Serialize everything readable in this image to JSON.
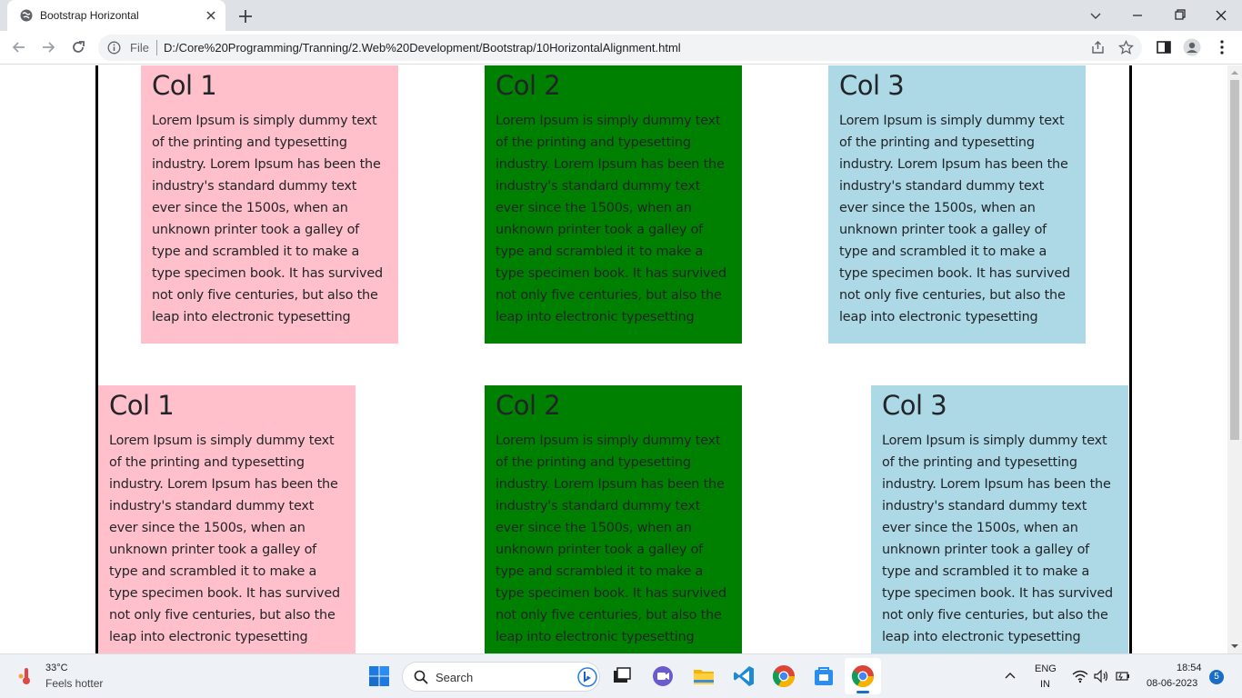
{
  "browser": {
    "tab_title": "Bootstrap Horizontal",
    "omnibox": {
      "scheme_label": "File",
      "url": "D:/Core%20Programming/Tranning/2.Web%20Development/Bootstrap/10HorizontalAlignment.html"
    }
  },
  "page": {
    "row1": [
      {
        "heading": "Col 1",
        "text": "Lorem Ipsum is simply dummy text of the printing and typesetting industry. Lorem Ipsum has been the industry's standard dummy text ever since the 1500s, when an unknown printer took a galley of type and scrambled it to make a type specimen book. It has survived not only five centuries, but also the leap into electronic typesetting",
        "bg": "#ffc0cb"
      },
      {
        "heading": "Col 2",
        "text": "Lorem Ipsum is simply dummy text of the printing and typesetting industry. Lorem Ipsum has been the industry's standard dummy text ever since the 1500s, when an unknown printer took a galley of type and scrambled it to make a type specimen book. It has survived not only five centuries, but also the leap into electronic typesetting",
        "bg": "#008000"
      },
      {
        "heading": "Col 3",
        "text": "Lorem Ipsum is simply dummy text of the printing and typesetting industry. Lorem Ipsum has been the industry's standard dummy text ever since the 1500s, when an unknown printer took a galley of type and scrambled it to make a type specimen book. It has survived not only five centuries, but also the leap into electronic typesetting",
        "bg": "#add8e6"
      }
    ],
    "row2": [
      {
        "heading": "Col 1",
        "text": "Lorem Ipsum is simply dummy text of the printing and typesetting industry. Lorem Ipsum has been the industry's standard dummy text ever since the 1500s, when an unknown printer took a galley of type and scrambled it to make a type specimen book. It has survived not only five centuries, but also the leap into electronic typesetting",
        "bg": "#ffc0cb"
      },
      {
        "heading": "Col 2",
        "text": "Lorem Ipsum is simply dummy text of the printing and typesetting industry. Lorem Ipsum has been the industry's standard dummy text ever since the 1500s, when an unknown printer took a galley of type and scrambled it to make a type specimen book. It has survived not only five centuries, but also the leap into electronic typesetting",
        "bg": "#008000"
      },
      {
        "heading": "Col 3",
        "text": "Lorem Ipsum is simply dummy text of the printing and typesetting industry. Lorem Ipsum has been the industry's standard dummy text ever since the 1500s, when an unknown printer took a galley of type and scrambled it to make a type specimen book. It has survived not only five centuries, but also the leap into electronic typesetting",
        "bg": "#add8e6"
      }
    ]
  },
  "taskbar": {
    "weather_temp": "33°C",
    "weather_desc": "Feels hotter",
    "search_placeholder": "Search",
    "lang_line1": "ENG",
    "lang_line2": "IN",
    "time": "18:54",
    "date": "08-06-2023",
    "notification_count": "5"
  },
  "icons": [
    "globe-icon",
    "close-icon",
    "plus-icon",
    "chevron-down-icon",
    "minimize-icon",
    "maximize-icon",
    "back-icon",
    "forward-icon",
    "reload-icon",
    "info-icon",
    "share-icon",
    "star-icon",
    "side-panel-icon",
    "profile-icon",
    "menu-icon",
    "windows-start-icon",
    "search-icon",
    "bing-icon",
    "file-explorer-icon",
    "vs-code-icon",
    "chrome-icon"
  ]
}
